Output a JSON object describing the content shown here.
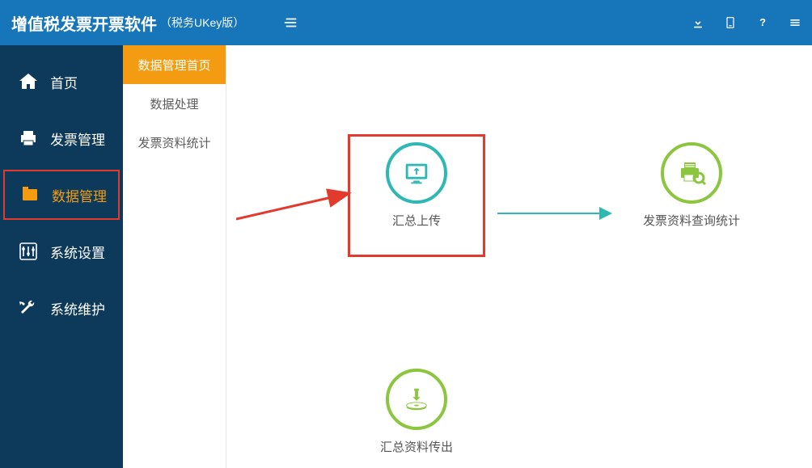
{
  "header": {
    "title": "增值税发票开票软件",
    "subtitle": "（税务UKey版）"
  },
  "sidebar": {
    "items": [
      {
        "label": "首页"
      },
      {
        "label": "发票管理"
      },
      {
        "label": "数据管理"
      },
      {
        "label": "系统设置"
      },
      {
        "label": "系统维护"
      }
    ]
  },
  "subnav": {
    "items": [
      {
        "label": "数据管理首页"
      },
      {
        "label": "数据处理"
      },
      {
        "label": "发票资料统计"
      }
    ]
  },
  "actions": {
    "upload": {
      "label": "汇总上传"
    },
    "query": {
      "label": "发票资料查询统计"
    },
    "export": {
      "label": "汇总资料传出"
    }
  }
}
